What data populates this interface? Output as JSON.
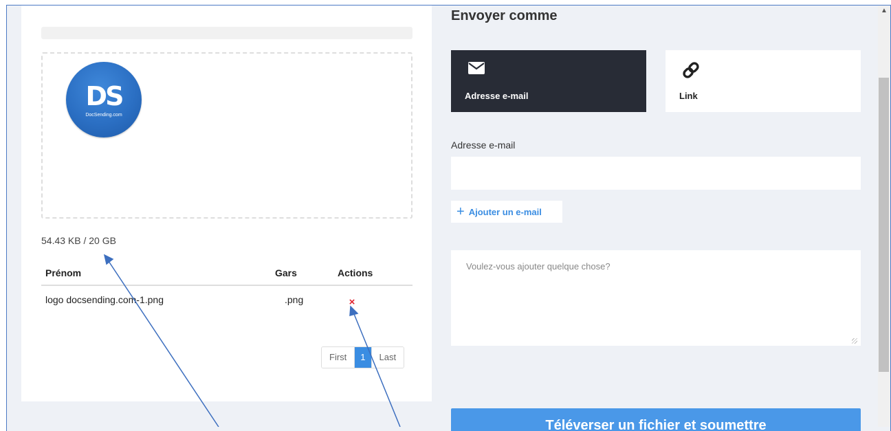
{
  "storage": {
    "usage_text": "54.43 KB / 20 GB"
  },
  "logo": {
    "mark": "DS",
    "subtitle": "DocSending.com"
  },
  "files_table": {
    "headers": {
      "name": "Prénom",
      "type": "Gars",
      "actions": "Actions"
    },
    "rows": [
      {
        "name": "logo docsending.com-1.png",
        "type": ".png",
        "delete_icon": "×"
      }
    ]
  },
  "pagination": {
    "first": "First",
    "current": "1",
    "last": "Last"
  },
  "send_panel": {
    "title": "Envoyer comme",
    "options": [
      {
        "label": "Adresse e-mail",
        "icon": "envelope-icon",
        "selected": true
      },
      {
        "label": "Link",
        "icon": "link-icon",
        "selected": false
      }
    ],
    "email_field_label": "Adresse e-mail",
    "email_value": "",
    "add_email_label": "Ajouter un e-mail",
    "message_placeholder": "Voulez-vous ajouter quelque chose?",
    "submit_label": "Téléverser un fichier et soumettre"
  },
  "colors": {
    "accent": "#4a98e8",
    "selected_tile": "#282c36",
    "delete": "#e0232f",
    "annotation": "#3d6fbf"
  }
}
